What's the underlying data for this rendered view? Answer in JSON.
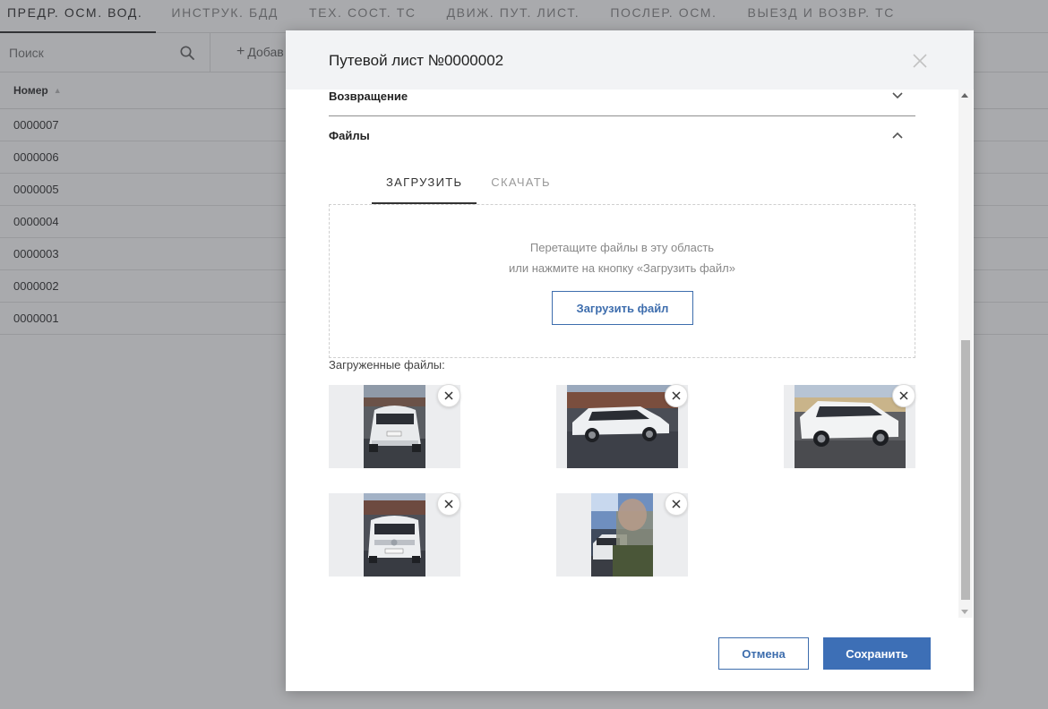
{
  "topnav": {
    "tabs": [
      {
        "label": "ПРЕДР. ОСМ. ВОД.",
        "active": true
      },
      {
        "label": "ИНСТРУК. БДД",
        "active": false
      },
      {
        "label": "ТЕХ. СОСТ. ТС",
        "active": false
      },
      {
        "label": "ДВИЖ. ПУТ. ЛИСТ.",
        "active": false
      },
      {
        "label": "ПОСЛЕР. ОСМ.",
        "active": false
      },
      {
        "label": "ВЫЕЗД И ВОЗВР. ТС",
        "active": false
      }
    ]
  },
  "toolbar": {
    "search_placeholder": "Поиск",
    "search_icon": "search-icon",
    "add_label": "Добав"
  },
  "table": {
    "column_header": "Номер",
    "sort_icon": "sort-asc-icon",
    "rows": [
      "0000007",
      "0000006",
      "0000005",
      "0000004",
      "0000003",
      "0000002",
      "0000001"
    ]
  },
  "modal": {
    "title": "Путевой лист №0000002",
    "close_icon": "close-icon",
    "sections": {
      "return_label": "Возвращение",
      "return_icon": "chevron-down-icon",
      "files_label": "Файлы",
      "files_icon": "chevron-up-icon"
    },
    "inner_tabs": [
      {
        "label": "ЗАГРУЗИТЬ",
        "active": true
      },
      {
        "label": "СКАЧАТЬ",
        "active": false
      }
    ],
    "dropzone": {
      "line1": "Перетащите файлы в эту область",
      "line2": "или нажмите на кнопку «Загрузить файл»",
      "button": "Загрузить файл"
    },
    "uploaded_label": "Загруженные файлы:",
    "files": [
      {
        "name": "car-rear-photo",
        "remove_icon": "remove-icon"
      },
      {
        "name": "car-side-photo",
        "remove_icon": "remove-icon"
      },
      {
        "name": "car-side-sunlit-photo",
        "remove_icon": "remove-icon"
      },
      {
        "name": "car-front-photo",
        "remove_icon": "remove-icon"
      },
      {
        "name": "person-car-photo",
        "remove_icon": "remove-icon"
      }
    ],
    "footer": {
      "cancel": "Отмена",
      "save": "Сохранить"
    }
  },
  "colors": {
    "accent": "#3d6fb6",
    "overlay": "#32343c"
  }
}
